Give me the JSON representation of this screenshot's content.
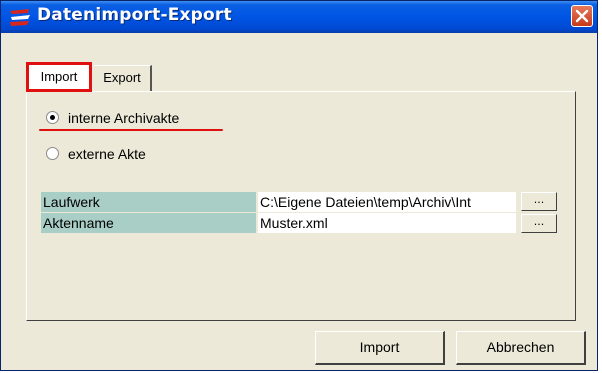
{
  "window": {
    "title": "Datenimport-Export"
  },
  "tabs": [
    {
      "label": "Import",
      "active": true
    },
    {
      "label": "Export",
      "active": false
    }
  ],
  "source": {
    "options": [
      {
        "label": "interne Archivakte",
        "checked": true
      },
      {
        "label": "externe Akte",
        "checked": false
      }
    ]
  },
  "fields": [
    {
      "label": "Laufwerk",
      "value": "C:\\Eigene Dateien\\temp\\Archiv\\Int",
      "browse_label": "..."
    },
    {
      "label": "Aktenname",
      "value": "Muster.xml",
      "browse_label": "..."
    }
  ],
  "buttons": {
    "import_label": "Import",
    "cancel_label": "Abbrechen"
  },
  "colors": {
    "titlebar": "#0055e5",
    "highlight": "#e01010",
    "field_label_bg": "#a9cec5"
  }
}
